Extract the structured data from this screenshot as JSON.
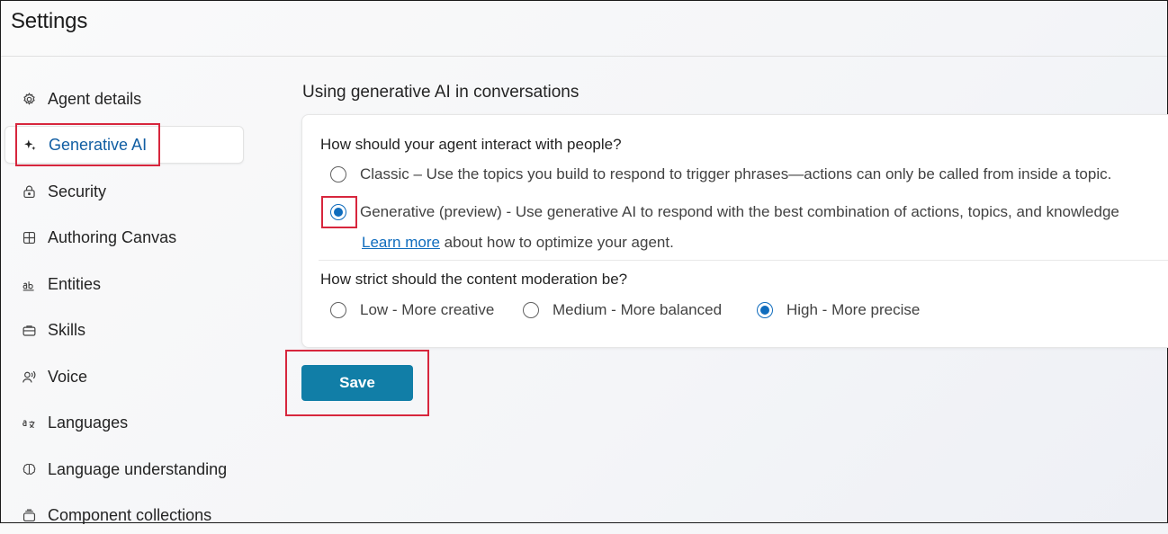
{
  "page": {
    "title": "Settings"
  },
  "sidebar": {
    "items": [
      {
        "label": "Agent details",
        "icon": "gear-icon"
      },
      {
        "label": "Generative AI",
        "icon": "sparkle-icon",
        "active": true
      },
      {
        "label": "Security",
        "icon": "lock-icon"
      },
      {
        "label": "Authoring Canvas",
        "icon": "grid-icon"
      },
      {
        "label": "Entities",
        "icon": "ab-text-icon"
      },
      {
        "label": "Skills",
        "icon": "briefcase-icon"
      },
      {
        "label": "Voice",
        "icon": "voice-icon"
      },
      {
        "label": "Languages",
        "icon": "translate-icon"
      },
      {
        "label": "Language understanding",
        "icon": "brain-icon"
      },
      {
        "label": "Component collections",
        "icon": "collection-icon"
      }
    ]
  },
  "main": {
    "section_title": "Using generative AI in conversations",
    "interaction": {
      "question": "How should your agent interact with people?",
      "options": [
        {
          "label": "Classic – Use the topics you build to respond to trigger phrases—actions can only be called from inside a topic.",
          "selected": false
        },
        {
          "label": "Generative (preview) - Use generative AI to respond with the best combination of actions, topics, and knowledge",
          "selected": true
        }
      ],
      "learn_more_link": "Learn more",
      "learn_more_suffix": " about how to optimize your agent."
    },
    "moderation": {
      "question": "How strict should the content moderation be?",
      "options": [
        {
          "label": "Low - More creative",
          "selected": false
        },
        {
          "label": "Medium - More balanced",
          "selected": false
        },
        {
          "label": "High - More precise",
          "selected": true
        }
      ]
    },
    "save_label": "Save"
  },
  "colors": {
    "accent": "#0f6cbd",
    "save_button": "#117ea7",
    "highlight_box": "#d7263d"
  }
}
